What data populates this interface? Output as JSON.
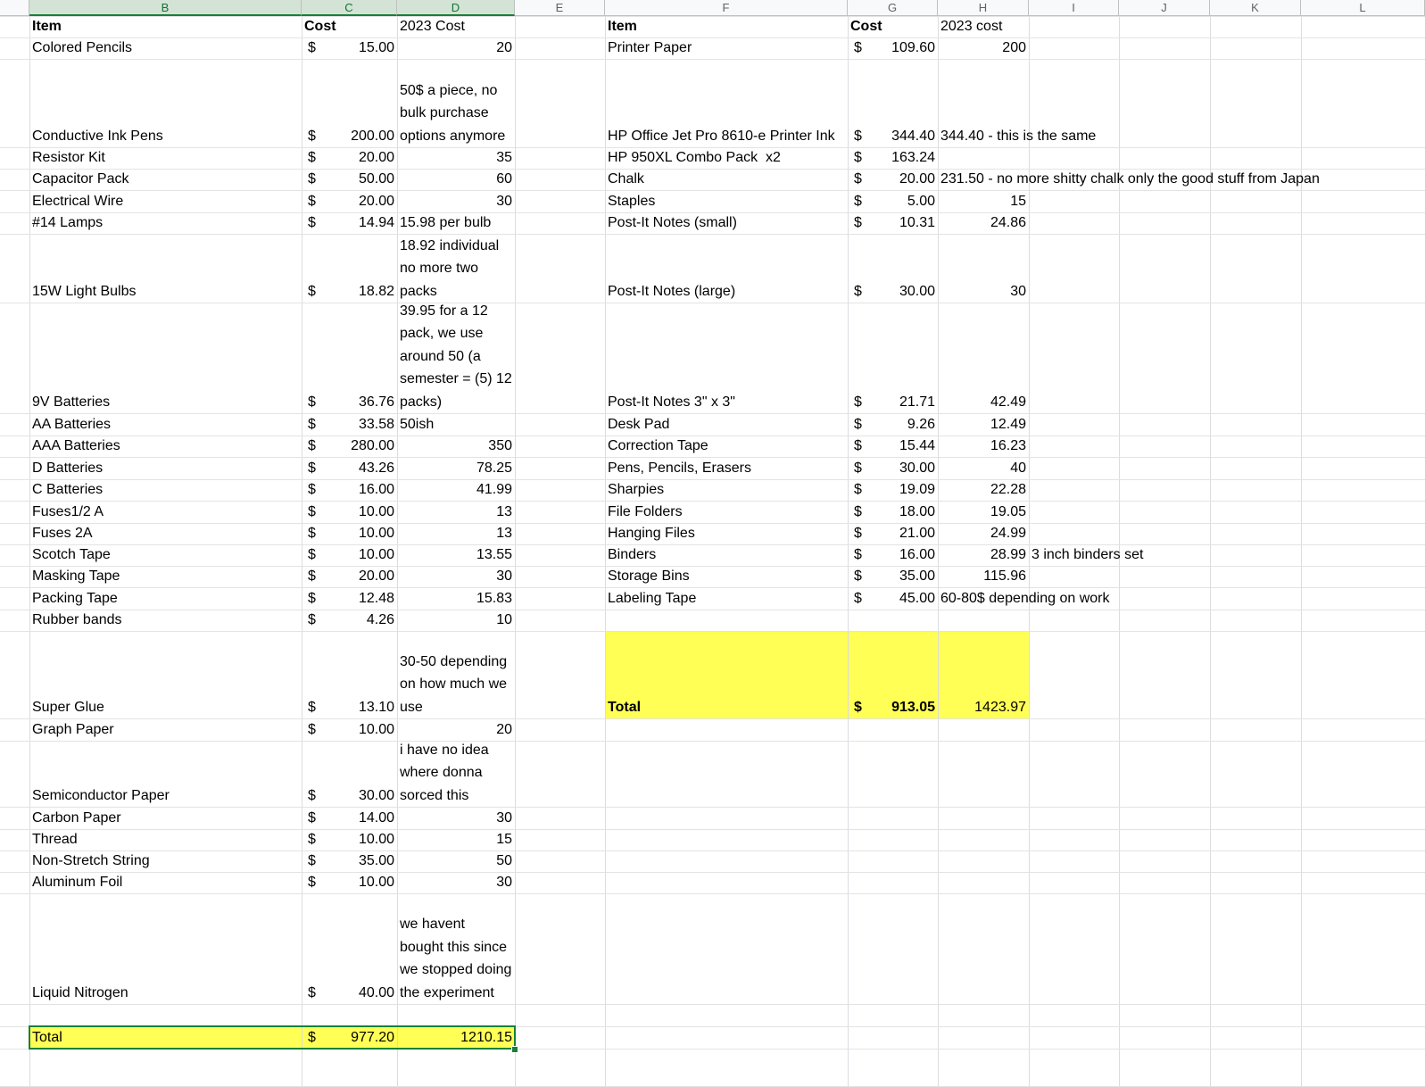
{
  "columns": [
    "B",
    "C",
    "D",
    "E",
    "F",
    "G",
    "H",
    "I",
    "J",
    "K",
    "L"
  ],
  "left_table": {
    "headers": [
      "Item",
      "Cost",
      "2023 Cost"
    ],
    "rows": [
      {
        "item": "Colored Pencils",
        "dollar": "$",
        "cost": "15.00",
        "c2023": "20"
      },
      {
        "item": "Conductive Ink Pens",
        "dollar": "$",
        "cost": "200.00",
        "c2023": "50$ a piece, no bulk purchase options anymore"
      },
      {
        "item": "Resistor Kit",
        "dollar": "$",
        "cost": "20.00",
        "c2023": "35"
      },
      {
        "item": "Capacitor Pack",
        "dollar": "$",
        "cost": "50.00",
        "c2023": "60"
      },
      {
        "item": "Electrical Wire",
        "dollar": "$",
        "cost": "20.00",
        "c2023": "30"
      },
      {
        "item": "#14 Lamps",
        "dollar": "$",
        "cost": "14.94",
        "c2023": "15.98 per bulb"
      },
      {
        "item": "15W Light Bulbs",
        "dollar": "$",
        "cost": "18.82",
        "c2023": "18.92 individual no more two packs"
      },
      {
        "item": "9V Batteries",
        "dollar": "$",
        "cost": "36.76",
        "c2023": "39.95 for a 12 pack, we use around 50 (a semester = (5) 12 packs)"
      },
      {
        "item": "AA Batteries",
        "dollar": "$",
        "cost": "33.58",
        "c2023": "50ish"
      },
      {
        "item": "AAA Batteries",
        "dollar": "$",
        "cost": "280.00",
        "c2023": "350"
      },
      {
        "item": "D Batteries",
        "dollar": "$",
        "cost": "43.26",
        "c2023": "78.25"
      },
      {
        "item": "C Batteries",
        "dollar": "$",
        "cost": "16.00",
        "c2023": "41.99"
      },
      {
        "item": "Fuses1/2 A",
        "dollar": "$",
        "cost": "10.00",
        "c2023": "13"
      },
      {
        "item": "Fuses 2A",
        "dollar": "$",
        "cost": "10.00",
        "c2023": "13"
      },
      {
        "item": "Scotch Tape",
        "dollar": "$",
        "cost": "10.00",
        "c2023": "13.55"
      },
      {
        "item": "Masking Tape",
        "dollar": "$",
        "cost": "20.00",
        "c2023": "30"
      },
      {
        "item": "Packing Tape",
        "dollar": "$",
        "cost": "12.48",
        "c2023": "15.83"
      },
      {
        "item": "Rubber bands",
        "dollar": "$",
        "cost": "4.26",
        "c2023": "10"
      },
      {
        "item": "Super Glue",
        "dollar": "$",
        "cost": "13.10",
        "c2023": "30-50 depending on how much we use"
      },
      {
        "item": "Graph Paper",
        "dollar": "$",
        "cost": "10.00",
        "c2023": "20"
      },
      {
        "item": "Semiconductor Paper",
        "dollar": "$",
        "cost": "30.00",
        "c2023": "i have no idea where donna sorced this"
      },
      {
        "item": "Carbon Paper",
        "dollar": "$",
        "cost": "14.00",
        "c2023": "30"
      },
      {
        "item": "Thread",
        "dollar": "$",
        "cost": "10.00",
        "c2023": "15"
      },
      {
        "item": "Non-Stretch String",
        "dollar": "$",
        "cost": "35.00",
        "c2023": "50"
      },
      {
        "item": "Aluminum Foil",
        "dollar": "$",
        "cost": "10.00",
        "c2023": "30"
      },
      {
        "item": "",
        "dollar": "",
        "cost": "",
        "c2023": ""
      },
      {
        "item": "Liquid Nitrogen",
        "dollar": "$",
        "cost": "40.00",
        "c2023": "we havent bought this since we stopped doing the experiment"
      }
    ],
    "total": {
      "label": "Total",
      "dollar": "$",
      "cost": "977.20",
      "c2023": "1210.15"
    }
  },
  "right_table": {
    "headers": [
      "Item",
      "Cost",
      "2023 cost"
    ],
    "rows": [
      {
        "item": "Printer Paper",
        "dollar": "$",
        "cost": "109.60",
        "c2023": "200",
        "note": ""
      },
      {
        "item": "HP Office Jet Pro 8610-e Printer Ink",
        "dollar": "$",
        "cost": "344.40",
        "c2023": "",
        "note": "344.40 - this is the same"
      },
      {
        "item": "HP 950XL Combo Pack  x2",
        "dollar": "$",
        "cost": "163.24",
        "c2023": "",
        "note": ""
      },
      {
        "item": "Chalk",
        "dollar": "$",
        "cost": "20.00",
        "c2023": "",
        "note": "231.50 - no more shitty chalk only the good stuff from Japan"
      },
      {
        "item": "Staples",
        "dollar": "$",
        "cost": "5.00",
        "c2023": "15",
        "note": ""
      },
      {
        "item": "Post-It Notes (small)",
        "dollar": "$",
        "cost": "10.31",
        "c2023": "24.86",
        "note": ""
      },
      {
        "item": "Post-It Notes (large)",
        "dollar": "$",
        "cost": "30.00",
        "c2023": "30",
        "note": ""
      },
      {
        "item": "Post-It Notes 3\" x 3\"",
        "dollar": "$",
        "cost": "21.71",
        "c2023": "42.49",
        "note": ""
      },
      {
        "item": "Desk Pad",
        "dollar": "$",
        "cost": "9.26",
        "c2023": "12.49",
        "note": ""
      },
      {
        "item": "Correction Tape",
        "dollar": "$",
        "cost": "15.44",
        "c2023": "16.23",
        "note": ""
      },
      {
        "item": "Pens, Pencils, Erasers",
        "dollar": "$",
        "cost": "30.00",
        "c2023": "40",
        "note": ""
      },
      {
        "item": "Sharpies",
        "dollar": "$",
        "cost": "19.09",
        "c2023": "22.28",
        "note": ""
      },
      {
        "item": "File Folders",
        "dollar": "$",
        "cost": "18.00",
        "c2023": "19.05",
        "note": ""
      },
      {
        "item": "Hanging Files",
        "dollar": "$",
        "cost": "21.00",
        "c2023": "24.99",
        "note": ""
      },
      {
        "item": "Binders",
        "dollar": "$",
        "cost": "16.00",
        "c2023": "28.99",
        "note": "3 inch binders set"
      },
      {
        "item": "Storage Bins",
        "dollar": "$",
        "cost": "35.00",
        "c2023": "115.96",
        "note": ""
      },
      {
        "item": "Labeling Tape",
        "dollar": "$",
        "cost": "45.00",
        "c2023": "",
        "note": "60-80$ depending on work"
      }
    ],
    "total": {
      "label": "Total",
      "dollar": "$",
      "cost": "913.05",
      "c2023": "1423.97"
    }
  },
  "colors": {
    "highlight": "#ffff55",
    "selection": "#188038",
    "grid": "#dadce0"
  }
}
